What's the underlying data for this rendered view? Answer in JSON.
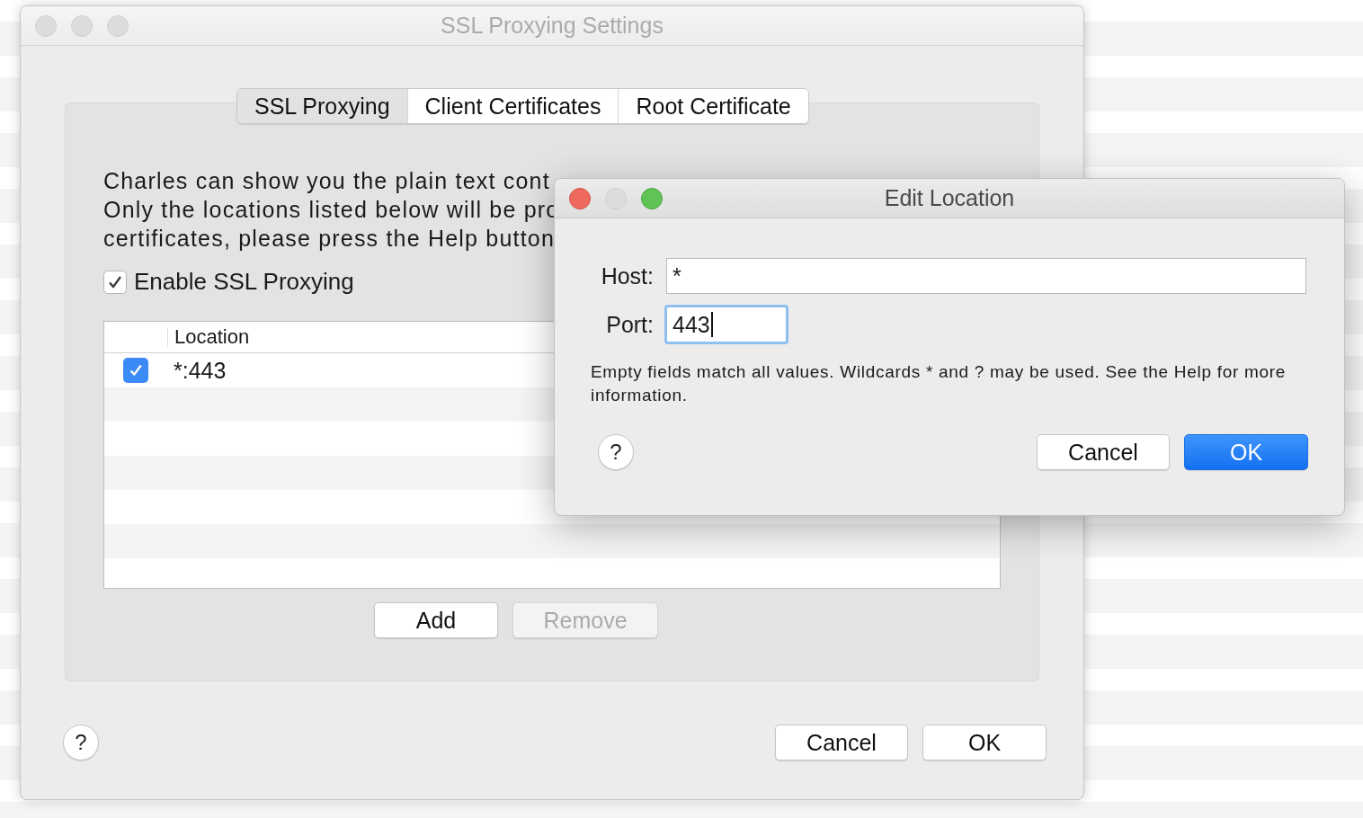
{
  "main_window": {
    "title": "SSL Proxying Settings",
    "tabs": [
      {
        "label": "SSL Proxying",
        "selected": true
      },
      {
        "label": "Client Certificates",
        "selected": false
      },
      {
        "label": "Root Certificate",
        "selected": false
      }
    ],
    "description_lines": [
      "Charles can show you the plain text cont",
      "Only the locations listed below will be pro",
      "certificates, please press the Help button"
    ],
    "enable_checkbox": {
      "label": "Enable SSL Proxying",
      "checked": true
    },
    "table": {
      "columns": [
        "Location"
      ],
      "rows": [
        {
          "enabled": true,
          "location": "*:443"
        }
      ]
    },
    "table_buttons": [
      {
        "label": "Add",
        "disabled": false
      },
      {
        "label": "Remove",
        "disabled": true
      }
    ],
    "help": "?",
    "footer_buttons": [
      {
        "label": "Cancel",
        "default": false
      },
      {
        "label": "OK",
        "default": false
      }
    ]
  },
  "dialog": {
    "title": "Edit Location",
    "fields": [
      {
        "label": "Host:",
        "value": "*",
        "focused": false,
        "kind": "wide"
      },
      {
        "label": "Port:",
        "value": "443",
        "focused": true,
        "kind": "narrow"
      }
    ],
    "info": "Empty fields match all values. Wildcards * and ? may be used. See the Help for more information.",
    "help": "?",
    "buttons": [
      {
        "label": "Cancel",
        "default": false
      },
      {
        "label": "OK",
        "default": true
      }
    ]
  }
}
